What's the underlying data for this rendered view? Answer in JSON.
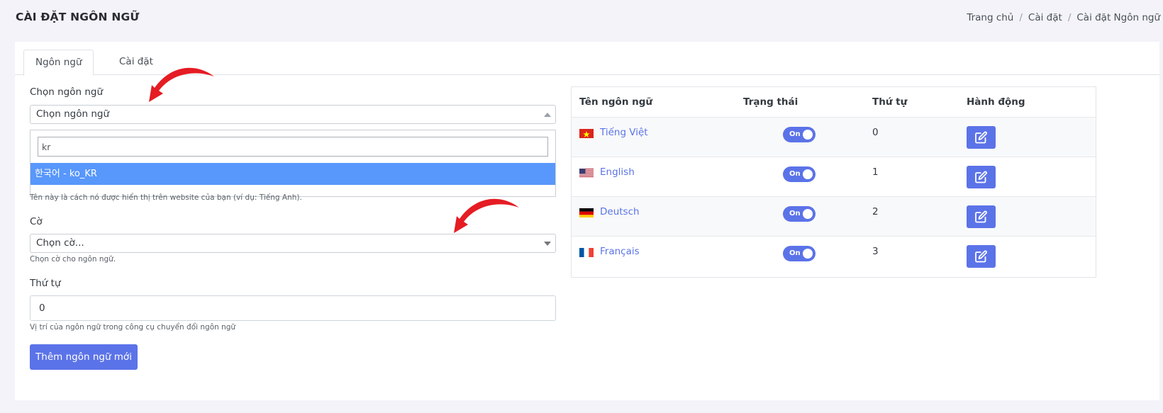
{
  "header": {
    "title": "CÀI ĐẶT NGÔN NGỮ",
    "breadcrumb": [
      "Trang chủ",
      "Cài đặt",
      "Cài đặt Ngôn ngữ"
    ]
  },
  "tabs": [
    {
      "label": "Ngôn ngữ",
      "active": true
    },
    {
      "label": "Cài đặt",
      "active": false
    }
  ],
  "form": {
    "language": {
      "label": "Chọn ngôn ngữ",
      "selected": "Chọn ngôn ngữ",
      "search_value": "kr",
      "highlighted_option": "한국어 - ko_KR",
      "help": "Tên này là cách nó được hiển thị trên website của bạn (ví dụ: Tiếng Anh)."
    },
    "flag": {
      "label": "Cờ",
      "selected": "Chọn cờ...",
      "help": "Chọn cờ cho ngôn ngữ."
    },
    "order": {
      "label": "Thứ tự",
      "value": "0",
      "help": "Vị trí của ngôn ngữ trong công cụ chuyển đổi ngôn ngữ"
    },
    "submit_label": "Thêm ngôn ngữ mới"
  },
  "table": {
    "headers": [
      "Tên ngôn ngữ",
      "Trạng thái",
      "Thứ tự",
      "Hành động"
    ],
    "rows": [
      {
        "name": "Tiếng Việt",
        "flag": "vn-flag-icon",
        "status": "On",
        "order": "0"
      },
      {
        "name": "English",
        "flag": "us-flag-icon",
        "status": "On",
        "order": "1"
      },
      {
        "name": "Deutsch",
        "flag": "de-flag-icon",
        "status": "On",
        "order": "2"
      },
      {
        "name": "Français",
        "flag": "fr-flag-icon",
        "status": "On",
        "order": "3"
      }
    ]
  },
  "colors": {
    "primary": "#5b73e8",
    "highlight": "#5897fb",
    "annotation_arrow": "#e51c23"
  },
  "icons": {
    "edit": "edit-icon",
    "annotation": "red-arrow-icon"
  }
}
